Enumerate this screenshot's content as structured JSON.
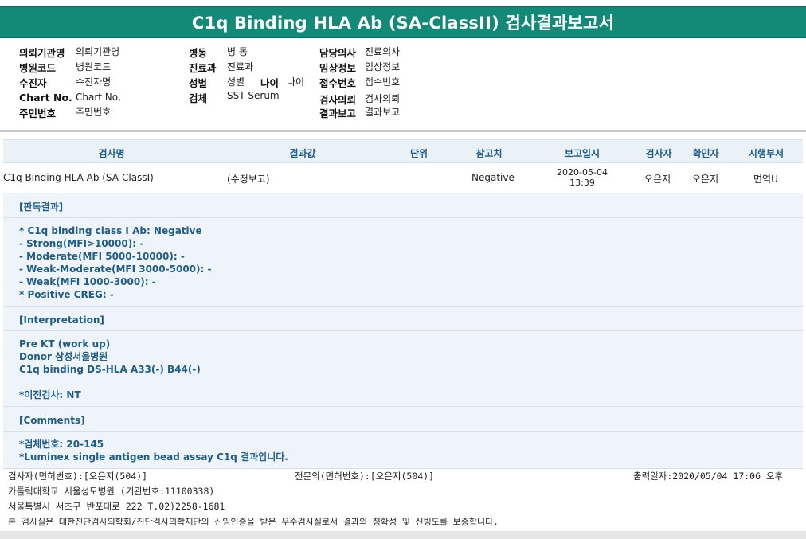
{
  "title": "C1q Binding HLA Ab (SA-ClassII) 검사결과보고서",
  "info": {
    "col1": [
      {
        "label": "의뢰기관명",
        "value": "의뢰기관명"
      },
      {
        "label": "병원코드",
        "value": "병원코드"
      },
      {
        "label": "수진자",
        "value": "수진자명"
      },
      {
        "label": "Chart No.",
        "value": "Chart No,"
      },
      {
        "label": "주민번호",
        "value": "주민번호"
      }
    ],
    "col2": [
      {
        "label": "병동",
        "value": "병 동"
      },
      {
        "label": "진료과",
        "value": "진료과"
      },
      {
        "label": "성별",
        "value": "성별"
      },
      {
        "label": "검체",
        "value": "SST Serum"
      }
    ],
    "age": {
      "label": "나이",
      "value": "나이"
    },
    "col3": [
      {
        "label": "담당의사",
        "value": "진료의사"
      },
      {
        "label": "임상정보",
        "value": "임상정보"
      },
      {
        "label": "접수번호",
        "value": "접수번호"
      },
      {
        "label": "검사의뢰",
        "value": "검사의뢰"
      },
      {
        "label": "결과보고",
        "value": "결과보고"
      }
    ]
  },
  "table": {
    "headers": [
      "검사명",
      "결과값",
      "단위",
      "참고치",
      "보고일시",
      "검사자",
      "확인자",
      "시행부서"
    ],
    "row": {
      "test_name": "C1q Binding HLA Ab (SA-ClassI)",
      "result": "(수정보고)",
      "unit": "",
      "reference": "Negative",
      "report_date": "2020-05-04",
      "report_time": "13:39",
      "tester": "오은지",
      "confirmer": "오은지",
      "department": "면역U"
    }
  },
  "details": {
    "judgement_title": "[판독결과]",
    "judgement_lines": [
      "* C1q binding class I Ab: Negative",
      "- Strong(MFI>10000): -",
      "- Moderate(MFI 5000-10000): -",
      "- Weak-Moderate(MFI 3000-5000): -",
      "- Weak(MFI 1000-3000): -",
      "* Positive CREG: -"
    ],
    "interpretation_title": "[Interpretation]",
    "interpretation_lines": [
      "Pre KT (work up)",
      "Donor 삼성서울병원",
      "C1q binding DS-HLA A33(-) B44(-)",
      "",
      "*이전검사: NT"
    ],
    "comments_title": "[Comments]",
    "comments_lines": [
      "*검체번호: 20-145",
      "*Luminex single antigen bead assay C1q 결과입니다."
    ]
  },
  "footer": {
    "tester_license": "검사자(면허번호):[오은지(504)]",
    "specialist_license": "전문의(면허번호):[오은지(504)]",
    "print_date": "출력일자:2020/05/04 17:06 오후",
    "hospital": "가톨릭대학교 서울성모병원 (기관번호:11100338)",
    "address": "서울특별시 서초구 반포대로 222 T.02)2258-1681",
    "certification": "본 검사실은 대한진단검사의학회/진단검사의학재단의 신임인증을 받은 우수검사실로서 결과의 정확성 및 신빙도를 보증합니다."
  },
  "colors": {
    "title_bg": "#138a78",
    "header_text": "#1f5d8a",
    "row_bg": "#eef4f9"
  }
}
